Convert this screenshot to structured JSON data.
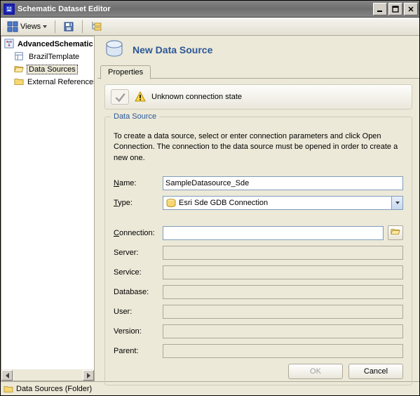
{
  "window": {
    "title": "Schematic Dataset Editor"
  },
  "toolbar": {
    "views_label": "Views"
  },
  "tree": {
    "root": "AdvancedSchematic",
    "items": [
      {
        "label": "BrazilTemplate",
        "icon": "template-icon"
      },
      {
        "label": "Data Sources",
        "icon": "folder-open-icon",
        "selected": true
      },
      {
        "label": "External References",
        "icon": "folder-closed-icon"
      }
    ]
  },
  "header": {
    "title": "New Data Source"
  },
  "tabs": {
    "properties": "Properties"
  },
  "status_banner": {
    "text": "Unknown connection state"
  },
  "groupbox": {
    "legend": "Data Source",
    "instructions": "To create a data source, select or enter connection parameters and click Open Connection.  The connection to the data source must be opened in order to create a new one."
  },
  "form": {
    "name_label": "Name:",
    "name_value": "SampleDatasource_Sde",
    "type_label": "Type:",
    "type_value": "Esri Sde GDB Connection",
    "connection_label": "Connection:",
    "connection_value": "",
    "server_label": "Server:",
    "server_value": "",
    "service_label": "Service:",
    "service_value": "",
    "database_label": "Database:",
    "database_value": "",
    "user_label": "User:",
    "user_value": "",
    "version_label": "Version:",
    "version_value": "",
    "parent_label": "Parent:",
    "parent_value": ""
  },
  "buttons": {
    "ok": "OK",
    "cancel": "Cancel"
  },
  "statusbar": {
    "text": "Data Sources (Folder)"
  }
}
